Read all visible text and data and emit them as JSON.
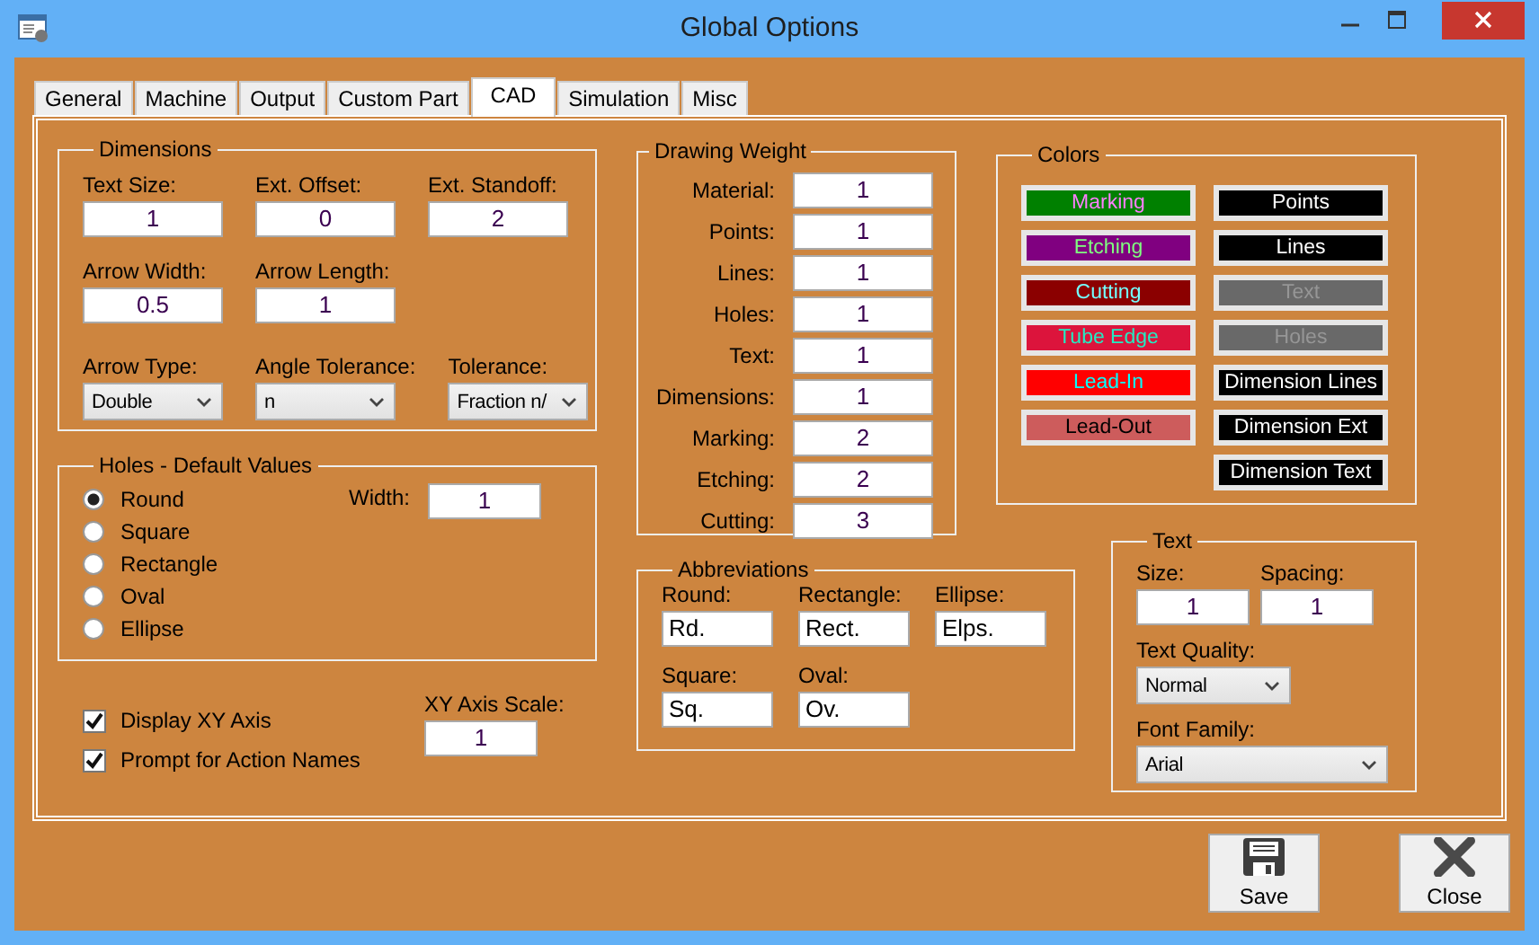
{
  "window": {
    "title": "Global Options"
  },
  "tabs": [
    {
      "label": "General",
      "selected": false
    },
    {
      "label": "Machine",
      "selected": false
    },
    {
      "label": "Output",
      "selected": false
    },
    {
      "label": "Custom Part",
      "selected": false
    },
    {
      "label": "CAD",
      "selected": true
    },
    {
      "label": "Simulation",
      "selected": false
    },
    {
      "label": "Misc",
      "selected": false
    }
  ],
  "dimensions": {
    "title": "Dimensions",
    "rows": [
      [
        {
          "label": "Text Size:",
          "value": "1",
          "kind": "text"
        },
        {
          "label": "Ext. Offset:",
          "value": "0",
          "kind": "text"
        },
        {
          "label": "Ext. Standoff:",
          "value": "2",
          "kind": "text"
        }
      ],
      [
        {
          "label": "Arrow Width:",
          "value": "0.5",
          "kind": "text"
        },
        {
          "label": "Arrow Length:",
          "value": "1",
          "kind": "text"
        }
      ],
      [
        {
          "label": "Arrow Type:",
          "value": "Double",
          "kind": "dropdown"
        },
        {
          "label": "Angle Tolerance:",
          "value": "n",
          "kind": "dropdown"
        },
        {
          "label": "Tolerance:",
          "value": "Fraction n/",
          "kind": "dropdown"
        }
      ]
    ]
  },
  "holes": {
    "title": "Holes - Default Values",
    "shapes": [
      {
        "label": "Round",
        "selected": true
      },
      {
        "label": "Square",
        "selected": false
      },
      {
        "label": "Rectangle",
        "selected": false
      },
      {
        "label": "Oval",
        "selected": false
      },
      {
        "label": "Ellipse",
        "selected": false
      }
    ],
    "width": {
      "label": "Width:",
      "value": "1"
    }
  },
  "options": [
    {
      "label": "Display XY Axis",
      "checked": true
    },
    {
      "label": "Prompt for Action Names",
      "checked": true
    }
  ],
  "xy_axis_scale": {
    "label": "XY Axis Scale:",
    "value": "1"
  },
  "drawing_weight": {
    "title": "Drawing Weight",
    "rows": [
      {
        "label": "Material:",
        "value": "1"
      },
      {
        "label": "Points:",
        "value": "1"
      },
      {
        "label": "Lines:",
        "value": "1"
      },
      {
        "label": "Holes:",
        "value": "1"
      },
      {
        "label": "Text:",
        "value": "1"
      },
      {
        "label": "Dimensions:",
        "value": "1"
      },
      {
        "label": "Marking:",
        "value": "2"
      },
      {
        "label": "Etching:",
        "value": "2"
      },
      {
        "label": "Cutting:",
        "value": "3"
      }
    ]
  },
  "abbreviations": {
    "title": "Abbreviations",
    "rows": [
      [
        {
          "label": "Round:",
          "value": "Rd."
        },
        {
          "label": "Rectangle:",
          "value": "Rect."
        },
        {
          "label": "Ellipse:",
          "value": "Elps."
        }
      ],
      [
        {
          "label": "Square:",
          "value": "Sq."
        },
        {
          "label": "Oval:",
          "value": "Ov."
        }
      ]
    ]
  },
  "colors": {
    "title": "Colors",
    "left": [
      {
        "label": "Marking",
        "color": "#008000"
      },
      {
        "label": "Etching",
        "color": "#800080"
      },
      {
        "label": "Cutting",
        "color": "#8b0000"
      },
      {
        "label": "Tube Edge",
        "color": "#dc143c"
      },
      {
        "label": "Lead-In",
        "color": "#ff0000"
      },
      {
        "label": "Lead-Out",
        "color": "#cd5c5c"
      }
    ],
    "right": [
      {
        "label": "Points",
        "color": "#000000"
      },
      {
        "label": "Lines",
        "color": "#000000"
      },
      {
        "label": "Text",
        "color": "#696969"
      },
      {
        "label": "Holes",
        "color": "#696969"
      },
      {
        "label": "Dimension Lines",
        "color": "#000000"
      },
      {
        "label": "Dimension Ext",
        "color": "#000000"
      },
      {
        "label": "Dimension Text",
        "color": "#000000"
      }
    ]
  },
  "text": {
    "title": "Text",
    "size": {
      "label": "Size:",
      "value": "1"
    },
    "spacing": {
      "label": "Spacing:",
      "value": "1"
    },
    "quality": {
      "label": "Text Quality:",
      "value": "Normal"
    },
    "font_family": {
      "label": "Font Family:",
      "value": "Arial"
    }
  },
  "buttons": [
    {
      "label": "Save",
      "kind": "save"
    },
    {
      "label": "Close",
      "kind": "close"
    }
  ]
}
